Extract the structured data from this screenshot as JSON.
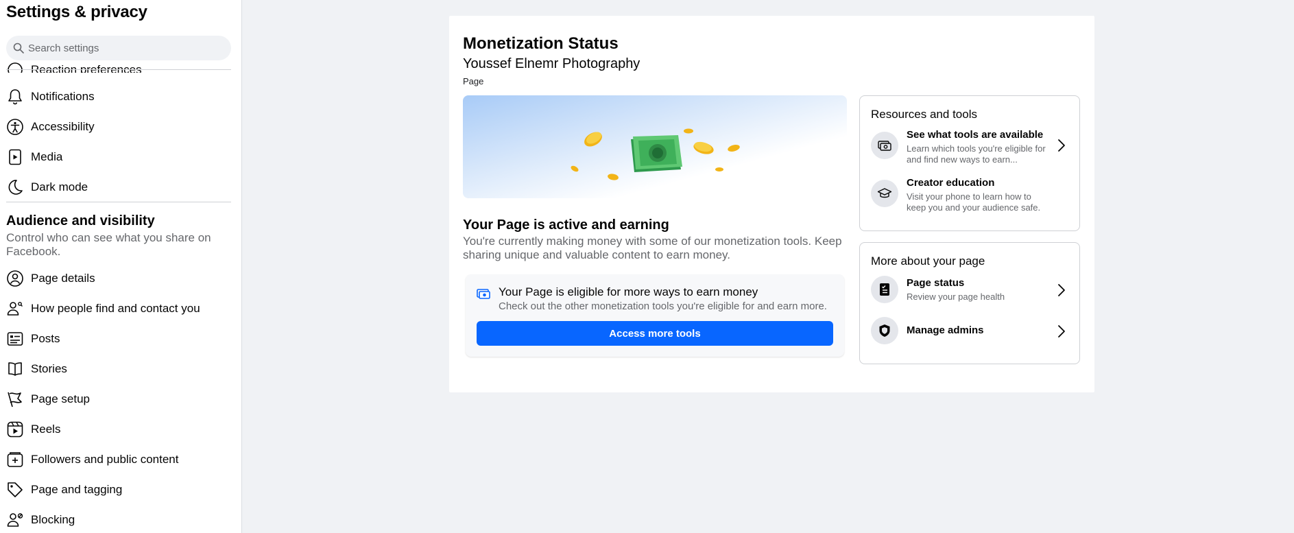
{
  "sidebar": {
    "title": "Settings & privacy",
    "search_placeholder": "Search settings",
    "partial_item": "Reaction preferences",
    "items_top": [
      {
        "label": "Notifications",
        "icon": "bell-icon"
      },
      {
        "label": "Accessibility",
        "icon": "accessibility-icon"
      },
      {
        "label": "Media",
        "icon": "media-icon"
      },
      {
        "label": "Dark mode",
        "icon": "moon-icon"
      }
    ],
    "section_title": "Audience and visibility",
    "section_subtitle": "Control who can see what you share on Facebook.",
    "items_audience": [
      {
        "label": "Page details",
        "icon": "profile-icon"
      },
      {
        "label": "How people find and contact you",
        "icon": "people-search-icon"
      },
      {
        "label": "Posts",
        "icon": "posts-icon"
      },
      {
        "label": "Stories",
        "icon": "book-icon"
      },
      {
        "label": "Page setup",
        "icon": "flag-icon"
      },
      {
        "label": "Reels",
        "icon": "reels-icon"
      },
      {
        "label": "Followers and public content",
        "icon": "add-content-icon"
      },
      {
        "label": "Page and tagging",
        "icon": "tag-icon"
      },
      {
        "label": "Blocking",
        "icon": "block-user-icon"
      }
    ]
  },
  "main": {
    "title": "Monetization Status",
    "page_name": "Youssef Elnemr Photography",
    "page_type": "Page",
    "active_title": "Your Page is active and earning",
    "active_desc": "You're currently making money with some of our monetization tools. Keep sharing unique and valuable content to earn money.",
    "eligible": {
      "title": "Your Page is eligible for more ways to earn money",
      "subtitle": "Check out the other monetization tools you're eligible for and earn more.",
      "button": "Access more tools"
    }
  },
  "resources": {
    "title": "Resources and tools",
    "items": [
      {
        "title": "See what tools are available",
        "subtitle": "Learn which tools you're eligible for and find new ways to earn...",
        "icon": "money-tools-icon"
      },
      {
        "title": "Creator education",
        "subtitle": "Visit your phone to learn how to keep you and your audience safe.",
        "icon": "graduation-cap-icon"
      }
    ]
  },
  "more": {
    "title": "More about your page",
    "items": [
      {
        "title": "Page status",
        "subtitle": "Review your page health",
        "icon": "checklist-icon"
      },
      {
        "title": "Manage admins",
        "subtitle": "",
        "icon": "shield-icon"
      }
    ]
  },
  "colors": {
    "primary": "#0866ff",
    "background": "#f0f2f5",
    "secondary_text": "#65676b"
  }
}
